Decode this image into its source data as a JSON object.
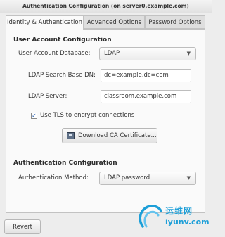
{
  "window": {
    "title": "Authentication Configuration (on server0.example.com)"
  },
  "tabs": [
    {
      "label": "Identity & Authentication",
      "active": true
    },
    {
      "label": "Advanced Options",
      "active": false
    },
    {
      "label": "Password Options",
      "active": false
    }
  ],
  "user_account": {
    "heading": "User Account Configuration",
    "database_label": "User Account Database:",
    "database_value": "LDAP",
    "search_base_label": "LDAP Search Base DN:",
    "search_base_value": "dc=example,dc=com",
    "server_label": "LDAP Server:",
    "server_value": "classroom.example.com",
    "tls_label": "Use TLS to encrypt connections",
    "tls_checked": true,
    "download_button": "Download CA Certificate..."
  },
  "authentication": {
    "heading": "Authentication Configuration",
    "method_label": "Authentication Method:",
    "method_value": "LDAP password"
  },
  "footer": {
    "revert_button": "Revert"
  },
  "watermark": {
    "cn_text": "运维网",
    "en_text": "iyunv.com"
  },
  "colors": {
    "accent": "#2d63b3",
    "watermark": "#1d9fd8"
  },
  "icons": {
    "dropdown": "chevron-down-icon",
    "certificate": "certificate-icon",
    "check": "check-icon"
  }
}
